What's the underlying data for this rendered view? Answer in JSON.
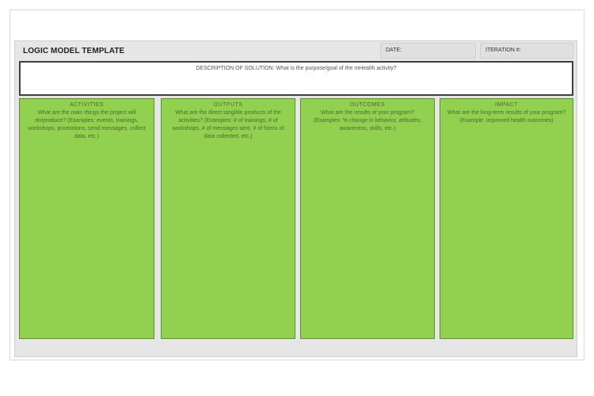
{
  "template": {
    "title": "LOGIC MODEL TEMPLATE",
    "date_label": "DATE:",
    "iteration_label": "ITERATION #:",
    "description": "DESCRIPTION OF SOLUTION: What is the purpose/goal of the mHealth activity?",
    "columns": [
      {
        "heading": "ACTIVITIES",
        "body": "What are the main things the project will do/produce? (Examples: events, trainings, workshops, promotions, send messages, collect data, etc.)"
      },
      {
        "heading": "OUTPUTS",
        "body": "What are the direct tangible products of the activities? (Examples: # of trainings, # of workshops, # of messages sent, # of forms of data collected, etc.)"
      },
      {
        "heading": "OUTCOMES",
        "body": "What are the results of your program? (Examples: % change in behavior, attitudes, awareness, skills, etc.)"
      },
      {
        "heading": "IMPACT",
        "body": "What are the long-term results of your program? (Example: Improved health outcomes)"
      }
    ]
  },
  "colors": {
    "column_fill": "#92d050",
    "header_field_fill": "#e0e0e0",
    "sheet_background": "#e6e6e6"
  }
}
